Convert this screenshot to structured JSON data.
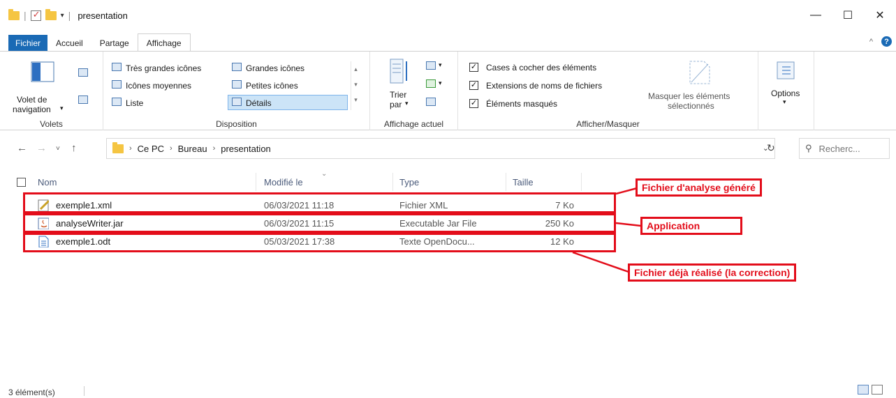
{
  "window": {
    "title": "presentation",
    "controls": {
      "minimize": "—",
      "maximize": "☐",
      "close": "✕"
    }
  },
  "ribbon_tabs": [
    "Fichier",
    "Accueil",
    "Partage",
    "Affichage"
  ],
  "ribbon": {
    "volets": {
      "nav_pane_label_1": "Volet de",
      "nav_pane_label_2": "navigation",
      "group_label": "Volets"
    },
    "disposition": {
      "items": [
        "Très grandes icônes",
        "Grandes icônes",
        "Icônes moyennes",
        "Petites icônes",
        "Liste",
        "Détails"
      ],
      "group_label": "Disposition"
    },
    "affichage_actuel": {
      "sort_label_1": "Trier",
      "sort_label_2": "par",
      "group_label": "Affichage actuel"
    },
    "afficher_masquer": {
      "checkboxes": [
        "Cases à cocher des éléments",
        "Extensions de noms de fichiers",
        "Éléments masqués"
      ],
      "hide_selected_1": "Masquer les éléments",
      "hide_selected_2": "sélectionnés",
      "group_label": "Afficher/Masquer"
    },
    "options": {
      "label": "Options"
    }
  },
  "address": {
    "breadcrumb": [
      "Ce PC",
      "Bureau",
      "presentation"
    ],
    "search_placeholder": "Recherc..."
  },
  "columns": {
    "name": "Nom",
    "modified": "Modifié le",
    "type": "Type",
    "size": "Taille"
  },
  "files": [
    {
      "name": "exemple1.xml",
      "modified": "06/03/2021 11:18",
      "type": "Fichier XML",
      "size": "7 Ko"
    },
    {
      "name": "analyseWriter.jar",
      "modified": "06/03/2021 11:15",
      "type": "Executable Jar File",
      "size": "250 Ko"
    },
    {
      "name": "exemple1.odt",
      "modified": "05/03/2021 17:38",
      "type": "Texte OpenDocu...",
      "size": "12 Ko"
    }
  ],
  "annotations": [
    "Fichier d'analyse généré",
    "Application",
    "Fichier déjà réalisé (la correction)"
  ],
  "annotation_color": "#e30d1a",
  "status": {
    "count": "3 élément(s)"
  }
}
